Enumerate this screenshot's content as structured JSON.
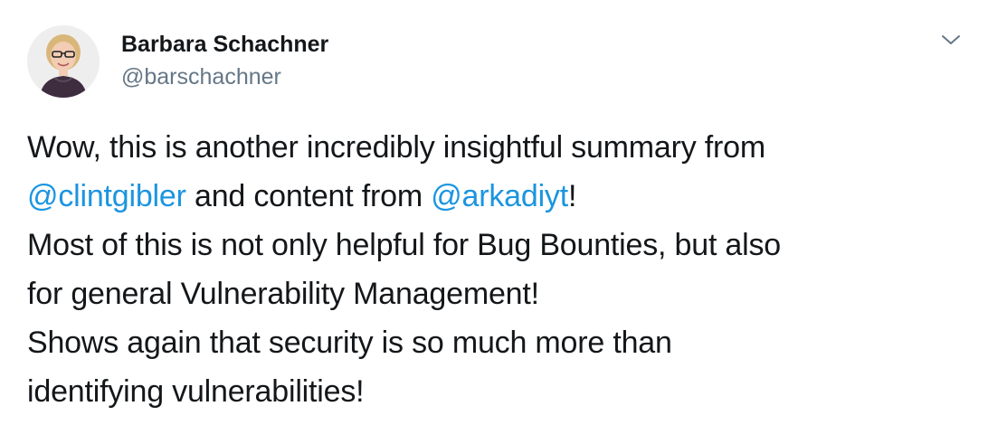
{
  "author": {
    "display_name": "Barbara Schachner",
    "handle": "@barschachner"
  },
  "menu": {
    "icon": "chevron-down-icon"
  },
  "tweet": {
    "line1": "Wow, this is another incredibly insightful summary from",
    "mention1": "@clintgibler",
    "line2_mid": " and content from ",
    "mention2": "@arkadiyt",
    "line2_end": "!",
    "line3": "Most of this is not only helpful for Bug Bounties, but also",
    "line4": "for general Vulnerability Management!",
    "line5": "Shows again that security is so much more than",
    "line6": "identifying vulnerabilities!"
  },
  "colors": {
    "text": "#14171a",
    "secondary": "#657786",
    "link": "#1b95e0",
    "background": "#ffffff"
  }
}
